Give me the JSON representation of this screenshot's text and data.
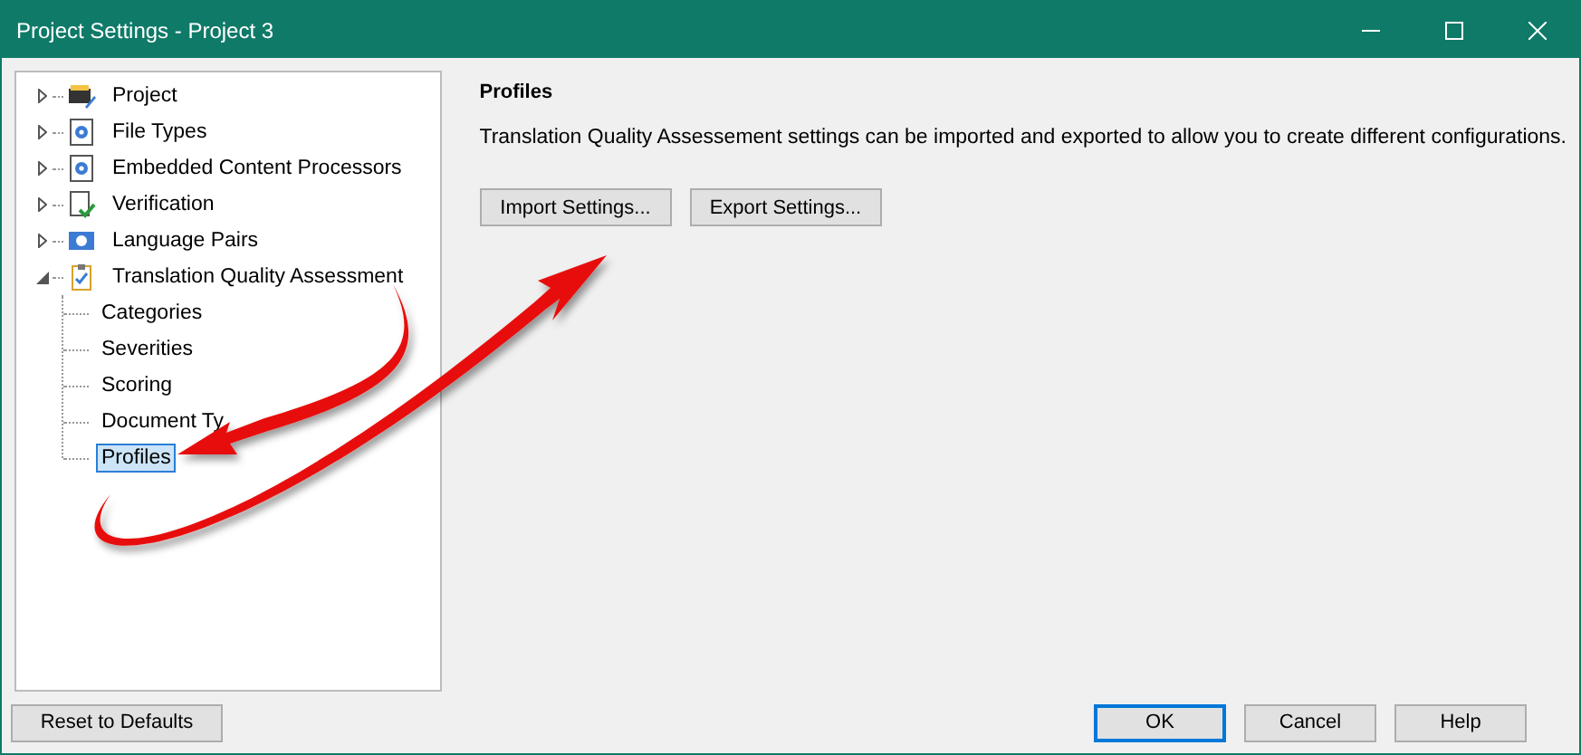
{
  "window": {
    "title": "Project Settings - Project 3"
  },
  "tree": [
    {
      "label": "Project",
      "kind": "project",
      "expanded": false,
      "selected": false
    },
    {
      "label": "File Types",
      "kind": "filetype",
      "expanded": false,
      "selected": false
    },
    {
      "label": "Embedded Content Processors",
      "kind": "filetype",
      "expanded": false,
      "selected": false
    },
    {
      "label": "Verification",
      "kind": "verification",
      "expanded": false,
      "selected": false
    },
    {
      "label": "Language Pairs",
      "kind": "languages",
      "expanded": false,
      "selected": false
    },
    {
      "label": "Translation Quality Assessment",
      "kind": "assessment",
      "expanded": true,
      "selected": false,
      "children": [
        {
          "label": "Categories",
          "selected": false
        },
        {
          "label": "Severities",
          "selected": false
        },
        {
          "label": "Scoring",
          "selected": false
        },
        {
          "label": "Document Ty",
          "selected": false
        },
        {
          "label": "Profiles",
          "selected": true
        }
      ]
    }
  ],
  "panel": {
    "heading": "Profiles",
    "description": "Translation Quality Assessement settings can be imported and exported to allow you to create different configurations.",
    "buttons": [
      "Import Settings...",
      "Export Settings..."
    ]
  },
  "footer": {
    "reset": "Reset to Defaults",
    "buttons": [
      {
        "label": "OK",
        "default": true
      },
      {
        "label": "Cancel",
        "default": false
      },
      {
        "label": "Help",
        "default": false
      }
    ]
  }
}
